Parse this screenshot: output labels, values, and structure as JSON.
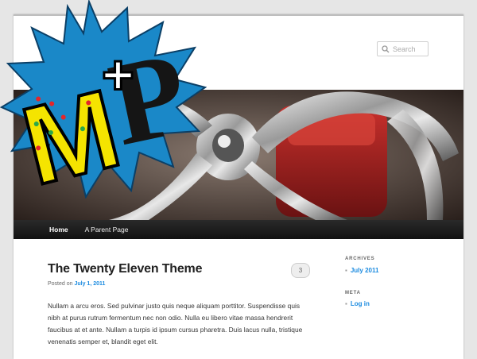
{
  "search": {
    "placeholder": "Search",
    "icon": "search-icon"
  },
  "nav": {
    "items": [
      {
        "label": "Home",
        "active": true
      },
      {
        "label": "A Parent Page",
        "active": false
      }
    ]
  },
  "post": {
    "title": "The Twenty Eleven Theme",
    "comments": "3",
    "posted_on": "Posted on",
    "date": "July 1, 2011",
    "body": "Nullam a arcu eros. Sed pulvinar justo quis neque aliquam porttitor. Suspendisse quis nibh at purus rutrum fermentum nec non odio. Nulla eu libero vitae massa hendrerit faucibus at et ante. Nullam a turpis id ipsum cursus pharetra. Duis lacus nulla, tristique venenatis semper et, blandit eget elit."
  },
  "sidebar": {
    "archives_title": "ARCHIVES",
    "archives_link": "July 2011",
    "meta_title": "META",
    "meta_link": "Log in"
  },
  "logo": {
    "text_left": "M",
    "plus": "+",
    "text_right": "P",
    "burst_color": "#1a88c8",
    "m_color": "#f5e400"
  },
  "colors": {
    "link": "#1b8be0",
    "nav_bg": "#1a1a1a"
  }
}
